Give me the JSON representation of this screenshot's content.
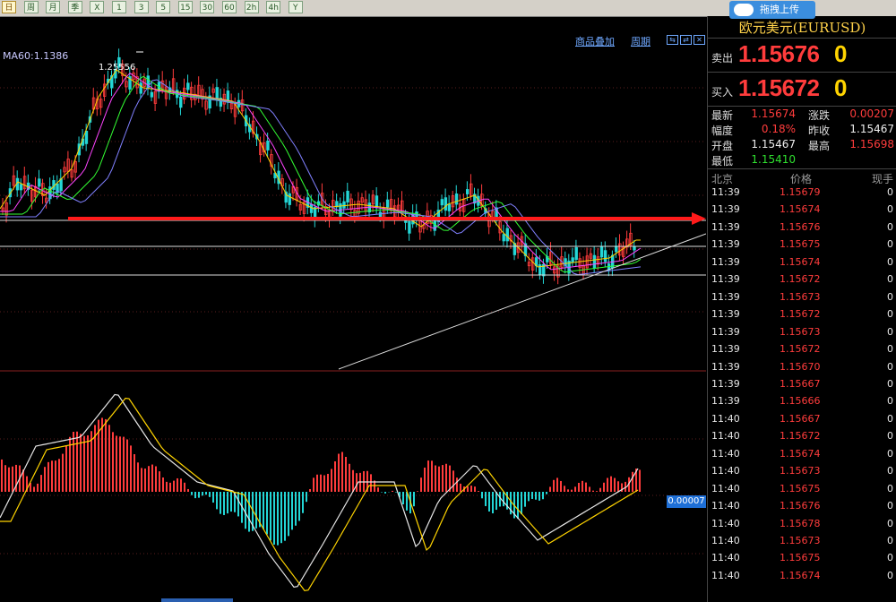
{
  "toolbar": {
    "buttons": [
      "日",
      "周",
      "月",
      "季",
      "X",
      "1",
      "3",
      "5",
      "15",
      "30",
      "60",
      "2h",
      "4h",
      "Y"
    ],
    "active_index": 0
  },
  "upload_label": "拖拽上传",
  "chart_header": {
    "overlay_label": "商品叠加",
    "period_label": "周期",
    "ma_label": "MA60:1.1386",
    "high_label": "1.25556",
    "macd_value": "0.00007"
  },
  "colors": {
    "up": "#ff3c3c",
    "down": "#23d6d6",
    "accent": "#ffd400",
    "arrow": "#ff1a1a"
  },
  "symbol": {
    "name": "欧元美元(EURUSD)",
    "sell_label": "卖出",
    "sell_price": "1.15676",
    "sell_vol": "0",
    "buy_label": "买入",
    "buy_price": "1.15672",
    "buy_vol": "0"
  },
  "stats": {
    "latest_label": "最新",
    "latest": "1.15674",
    "change_label": "涨跌",
    "change": "0.00207",
    "amp_label": "幅度",
    "amp": "0.18%",
    "prev_label": "昨收",
    "prev": "1.15467",
    "open_label": "开盘",
    "open": "1.15467",
    "high_label": "最高",
    "high": "1.15698",
    "low_label": "最低",
    "low": "1.15410"
  },
  "ticks": {
    "headers": [
      "北京",
      "价格",
      "现手"
    ],
    "rows": [
      {
        "time": "11:39",
        "price": "1.15679",
        "vol": "0"
      },
      {
        "time": "11:39",
        "price": "1.15674",
        "vol": "0"
      },
      {
        "time": "11:39",
        "price": "1.15676",
        "vol": "0"
      },
      {
        "time": "11:39",
        "price": "1.15675",
        "vol": "0"
      },
      {
        "time": "11:39",
        "price": "1.15674",
        "vol": "0"
      },
      {
        "time": "11:39",
        "price": "1.15672",
        "vol": "0"
      },
      {
        "time": "11:39",
        "price": "1.15673",
        "vol": "0"
      },
      {
        "time": "11:39",
        "price": "1.15672",
        "vol": "0"
      },
      {
        "time": "11:39",
        "price": "1.15673",
        "vol": "0"
      },
      {
        "time": "11:39",
        "price": "1.15672",
        "vol": "0"
      },
      {
        "time": "11:39",
        "price": "1.15670",
        "vol": "0"
      },
      {
        "time": "11:39",
        "price": "1.15667",
        "vol": "0"
      },
      {
        "time": "11:39",
        "price": "1.15666",
        "vol": "0"
      },
      {
        "time": "11:40",
        "price": "1.15667",
        "vol": "0"
      },
      {
        "time": "11:40",
        "price": "1.15672",
        "vol": "0"
      },
      {
        "time": "11:40",
        "price": "1.15674",
        "vol": "0"
      },
      {
        "time": "11:40",
        "price": "1.15673",
        "vol": "0"
      },
      {
        "time": "11:40",
        "price": "1.15675",
        "vol": "0"
      },
      {
        "time": "11:40",
        "price": "1.15676",
        "vol": "0"
      },
      {
        "time": "11:40",
        "price": "1.15678",
        "vol": "0"
      },
      {
        "time": "11:40",
        "price": "1.15673",
        "vol": "0"
      },
      {
        "time": "11:40",
        "price": "1.15675",
        "vol": "0"
      },
      {
        "time": "11:40",
        "price": "1.15674",
        "vol": "0"
      }
    ]
  }
}
